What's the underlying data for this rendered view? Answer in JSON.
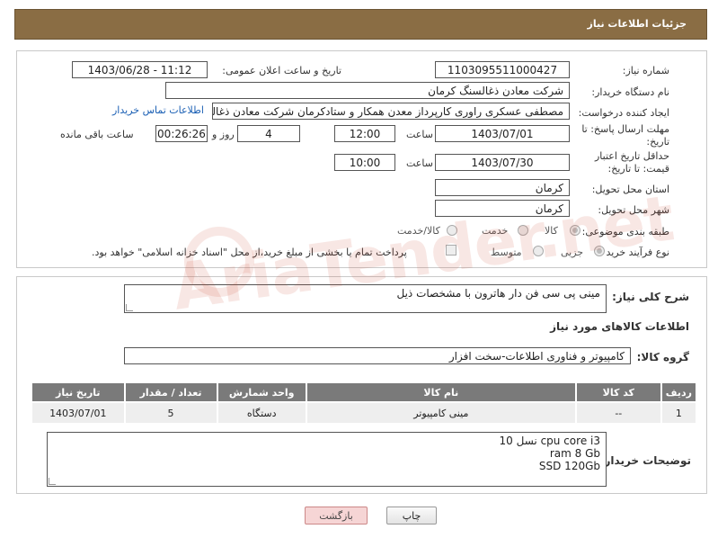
{
  "header": {
    "title": "جزئیات اطلاعات نیاز"
  },
  "details": {
    "need_number_label": "شماره نیاز:",
    "need_number": "1103095511000427",
    "announce_label": "تاریخ و ساعت اعلان عمومی:",
    "announce_value": "1403/06/28 - 11:12",
    "buyer_org_label": "نام دستگاه خریدار:",
    "buyer_org": "شرکت معادن ذغالسنگ کرمان",
    "requester_label": "ایجاد کننده درخواست:",
    "requester": "مصطفی عسکری راوری کارپرداز معدن همکار و ستادکرمان شرکت معادن ذغالسنگ کرمان",
    "contact_link": "اطلاعات تماس خریدار",
    "reply_deadline_label": "مهلت ارسال پاسخ: تا تاریخ:",
    "reply_date": "1403/07/01",
    "time_label": "ساعت",
    "reply_time": "12:00",
    "days_value": "4",
    "days_label": "روز و",
    "remaining_time": "00:26:26",
    "remaining_label": "ساعت باقی مانده",
    "price_validity_label": "حداقل تاریخ اعتبار قیمت: تا تاریخ:",
    "validity_date": "1403/07/30",
    "validity_time": "10:00",
    "province_label": "استان محل تحویل:",
    "province": "کرمان",
    "city_label": "شهر محل تحویل:",
    "city": "کرمان",
    "category_label": "طبقه بندی موضوعی:",
    "category_options": [
      "کالا",
      "خدمت",
      "کالا/خدمت"
    ],
    "process_label": "نوع فرآیند خرید :",
    "process_options": [
      "جزیی",
      "متوسط"
    ],
    "payment_note": "پرداخت تمام یا بخشی از مبلغ خرید،از محل \"اسناد خزانه اسلامی\" خواهد بود."
  },
  "summary": {
    "description_label": "شرح کلی نیاز:",
    "description": "مینی پی سی فن دار هاترون با مشخصات ذیل",
    "goods_info_title": "اطلاعات کالاهای مورد نیاز",
    "goods_group_label": "گروه کالا:",
    "goods_group": "کامپیوتر و فناوری اطلاعات-سخت افزار"
  },
  "table": {
    "headers": [
      "ردیف",
      "کد کالا",
      "نام کالا",
      "واحد شمارش",
      "تعداد / مقدار",
      "تاریخ نیاز"
    ],
    "rows": [
      [
        "1",
        "--",
        "مینی کامپیوتر",
        "دستگاه",
        "5",
        "1403/07/01"
      ]
    ]
  },
  "buyer_notes": {
    "label": "توضیحات خریدار:",
    "lines": [
      "cpu core i3 نسل 10",
      "ram 8 Gb",
      "SSD 120Gb"
    ]
  },
  "buttons": {
    "print": "چاپ",
    "back": "بازگشت"
  },
  "watermark": "AriaTender.net"
}
